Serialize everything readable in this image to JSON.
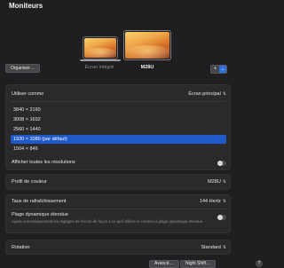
{
  "header": {
    "title": "Moniteurs"
  },
  "displays": {
    "builtin_label": "Écran intégré",
    "external_label": "M28U"
  },
  "toolbar": {
    "arrange_label": "Organiser…",
    "add_label": "+",
    "add_menu_icon": "chevron-down-icon"
  },
  "use_as": {
    "label": "Utiliser comme",
    "value": "Écran principal"
  },
  "resolutions": {
    "options": [
      "3840 × 2160",
      "3008 × 1692",
      "2560 × 1440",
      "1920 × 1080 (par défaut)",
      "1504 × 846"
    ],
    "selected_index": 3
  },
  "show_all": {
    "label": "Afficher toutes les résolutions",
    "on": false
  },
  "color_profile": {
    "label": "Profil de couleur",
    "value": "M28U"
  },
  "refresh": {
    "label": "Taux de rafraîchissement",
    "value": "144 Hertz"
  },
  "hdr": {
    "label": "Plage dynamique étendue",
    "description": "Ajuste automatiquement les réglages de l'écran de façon à ce qu'il affiche le contenu à plage dynamique étendue.",
    "on": false
  },
  "rotation": {
    "label": "Rotation",
    "value": "Standard"
  },
  "footer": {
    "advanced_label": "Avancé…",
    "night_shift_label": "Night Shift…",
    "help_label": "?"
  },
  "colors": {
    "accent": "#2059c8",
    "background": "#1f1f21",
    "panel": "#2a2a2c"
  }
}
